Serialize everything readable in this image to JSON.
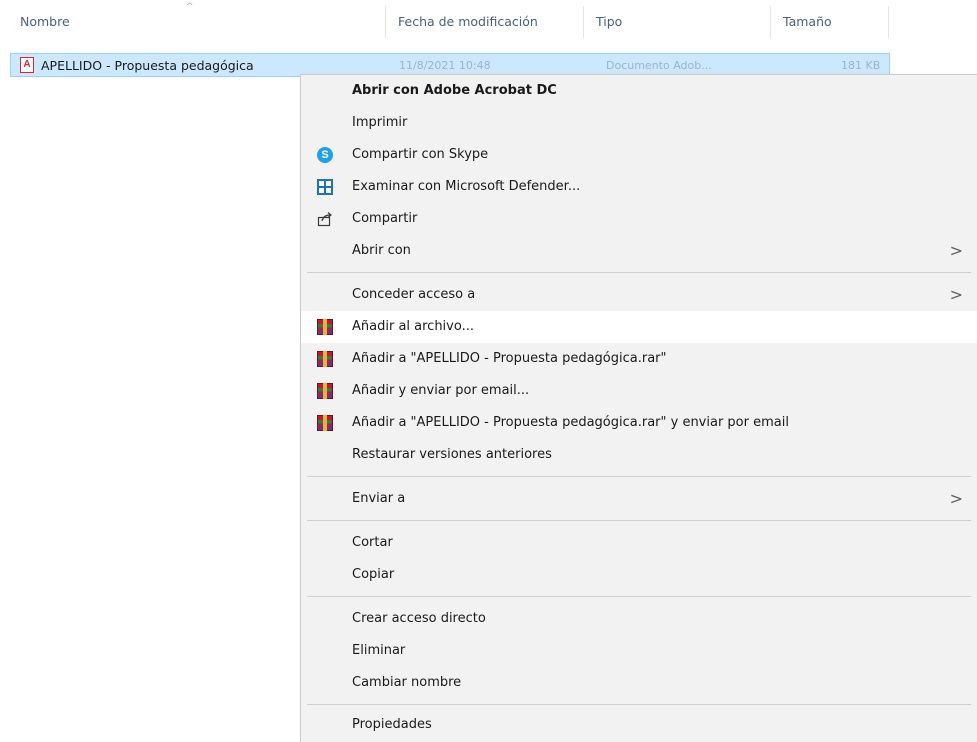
{
  "columns": {
    "name": "Nombre",
    "modified": "Fecha de modificación",
    "type": "Tipo",
    "size": "Tamaño",
    "sort_indicator": "^"
  },
  "file": {
    "icon": "pdf-icon",
    "icon_glyph": "A",
    "name": "APELLIDO - Propuesta pedagógica",
    "modified": "11/8/2021 10:48",
    "type": "Documento Adob...",
    "size": "181 KB"
  },
  "context_menu": {
    "items": [
      {
        "label": "Abrir con Adobe Acrobat DC",
        "bold": true
      },
      {
        "label": "Imprimir"
      },
      {
        "label": "Compartir con Skype",
        "icon": "skype-icon"
      },
      {
        "label": "Examinar con Microsoft Defender...",
        "icon": "defender-icon"
      },
      {
        "label": "Compartir",
        "icon": "share-icon"
      },
      {
        "label": "Abrir con",
        "submenu": true
      },
      {
        "label": "Conceder acceso a",
        "submenu": true
      },
      {
        "label": "Añadir al archivo...",
        "icon": "winrar-icon",
        "hovered": true
      },
      {
        "label": "Añadir a \"APELLIDO - Propuesta pedagógica.rar\"",
        "icon": "winrar-icon"
      },
      {
        "label": "Añadir y enviar por email...",
        "icon": "winrar-icon"
      },
      {
        "label": "Añadir a \"APELLIDO - Propuesta pedagógica.rar\" y enviar por email",
        "icon": "winrar-icon"
      },
      {
        "label": "Restaurar versiones anteriores"
      },
      {
        "label": "Enviar a",
        "submenu": true
      },
      {
        "label": "Cortar"
      },
      {
        "label": "Copiar"
      },
      {
        "label": "Crear acceso directo"
      },
      {
        "label": "Eliminar"
      },
      {
        "label": "Cambiar nombre"
      },
      {
        "label": "Propiedades"
      }
    ],
    "submenu_arrow": ">",
    "skype_glyph": "S"
  }
}
